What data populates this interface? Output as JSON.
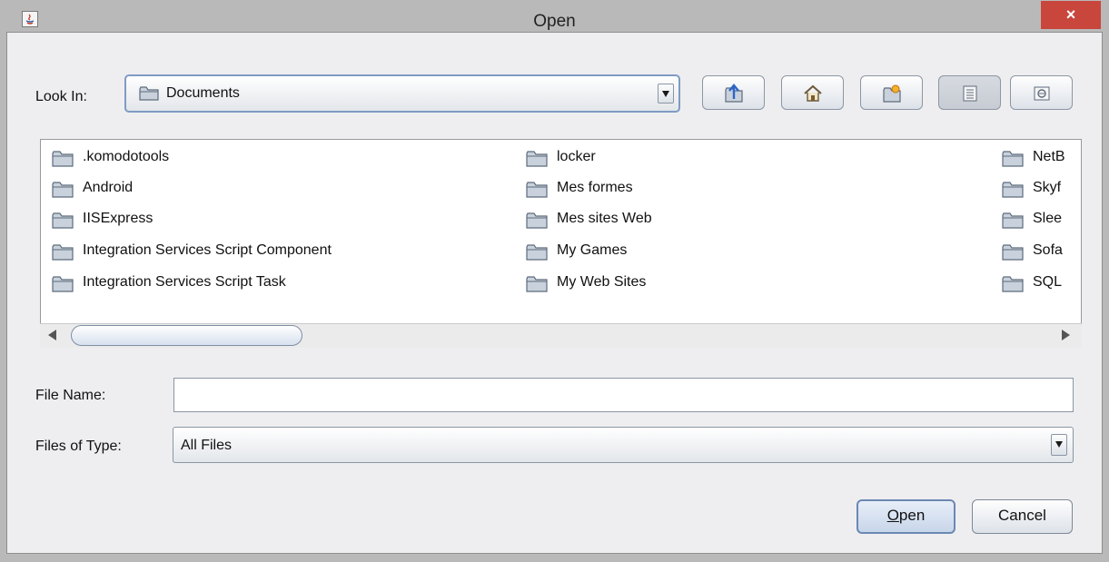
{
  "window": {
    "title": "Open",
    "close_label": "×"
  },
  "look_in": {
    "label": "Look In:",
    "value": "Documents"
  },
  "toolbar": [
    {
      "name": "up-one-level",
      "icon": "folder-up-icon"
    },
    {
      "name": "home",
      "icon": "home-icon"
    },
    {
      "name": "create-new-folder",
      "icon": "new-folder-icon"
    },
    {
      "name": "list-view",
      "icon": "list-view-icon",
      "selected": true
    },
    {
      "name": "details-view",
      "icon": "details-view-icon",
      "selected": false
    }
  ],
  "files": {
    "columns": [
      [
        ".komodotools",
        "Android",
        "IISExpress",
        "Integration Services Script Component",
        "Integration Services Script Task"
      ],
      [
        "locker",
        "Mes formes",
        "Mes sites Web",
        "My Games",
        "My Web Sites"
      ],
      [
        "NetB",
        "Skyf",
        "Slee",
        "Sofa",
        "SQL"
      ]
    ]
  },
  "file_name": {
    "label": "File Name:",
    "value": ""
  },
  "file_type": {
    "label": "Files of Type:",
    "value": "All Files"
  },
  "buttons": {
    "open_mnemonic": "O",
    "open_rest": "pen",
    "cancel": "Cancel"
  },
  "colors": {
    "close_button": "#c9463d",
    "folder_body": "#c9d2dc",
    "folder_edge": "#5d6b7c"
  }
}
